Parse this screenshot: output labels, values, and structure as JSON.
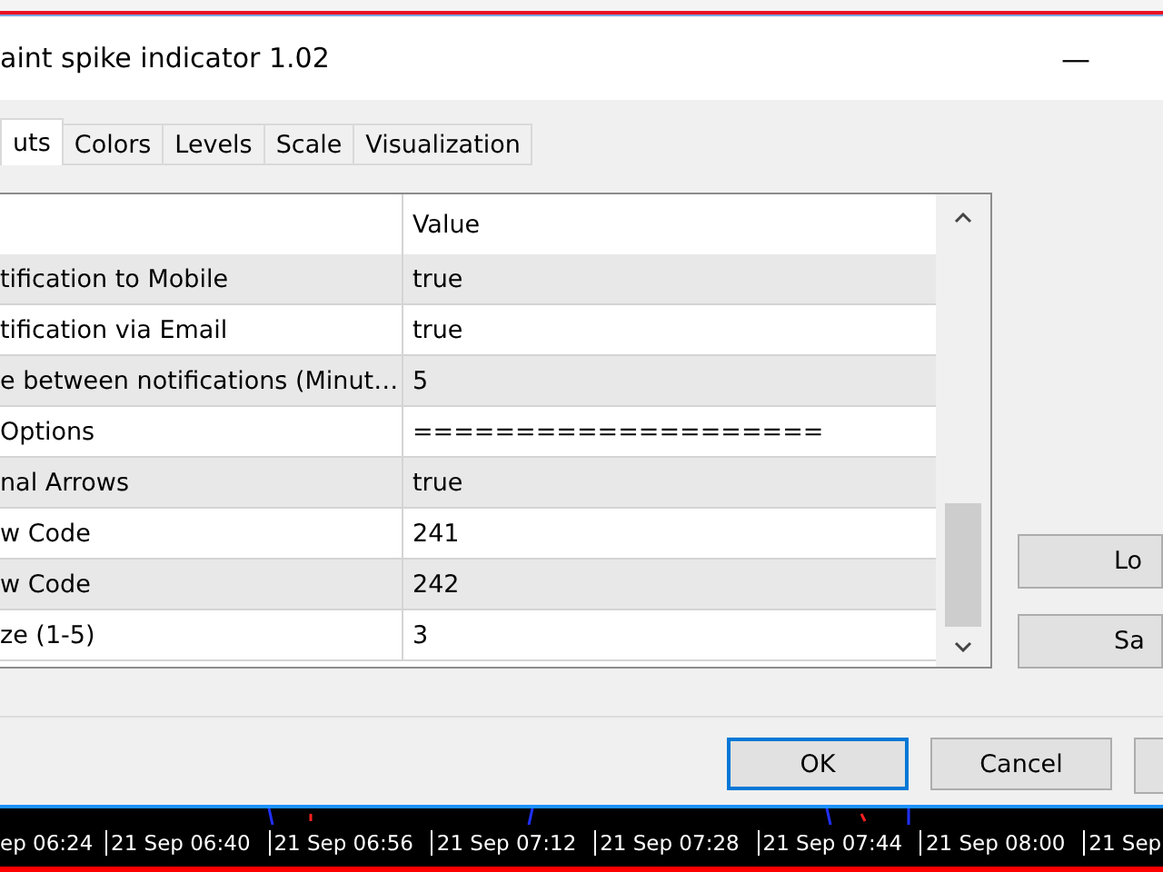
{
  "window": {
    "title": "aint spike indicator 1.02",
    "minimize": "—"
  },
  "tabs": [
    {
      "label": "uts",
      "selected": true
    },
    {
      "label": "Colors",
      "selected": false
    },
    {
      "label": "Levels",
      "selected": false
    },
    {
      "label": "Scale",
      "selected": false
    },
    {
      "label": "Visualization",
      "selected": false
    }
  ],
  "table": {
    "columns": [
      "Value"
    ],
    "rows": [
      {
        "name": "tification to Mobile",
        "value": "true"
      },
      {
        "name": "tification via Email",
        "value": "true"
      },
      {
        "name": "e between notifications (Minut…",
        "value": "5"
      },
      {
        "name": "Options",
        "value": "===================="
      },
      {
        "name": "nal Arrows",
        "value": "true"
      },
      {
        "name": "w Code",
        "value": "241"
      },
      {
        "name": "w Code",
        "value": "242"
      },
      {
        "name": "ze (1-5)",
        "value": "3"
      }
    ]
  },
  "side_buttons": [
    "Lo",
    "Sa"
  ],
  "buttons": [
    {
      "label": "OK",
      "selected": true
    },
    {
      "label": "Cancel",
      "selected": false
    }
  ],
  "time_axis": [
    "ep 06:24",
    "21 Sep 06:40",
    "21 Sep 06:56",
    "21 Sep 07:12",
    "21 Sep 07:28",
    "21 Sep 07:44",
    "21 Sep 08:00",
    "21 Sep"
  ]
}
